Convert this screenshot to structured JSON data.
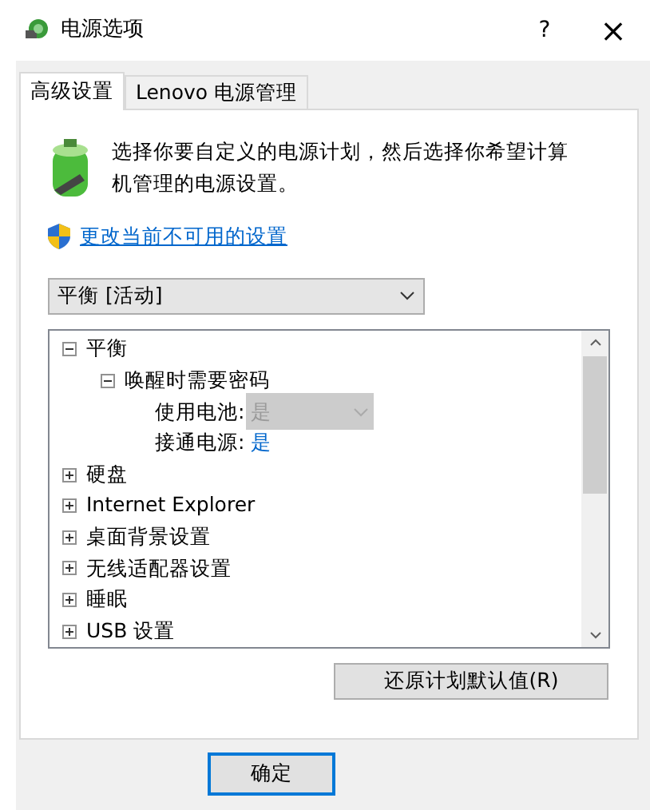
{
  "window": {
    "title": "电源选项",
    "help": "?",
    "close": "×"
  },
  "tabs": [
    {
      "label": "高级设置",
      "selected": true
    },
    {
      "label": "Lenovo 电源管理",
      "selected": false
    }
  ],
  "intro": "选择你要自定义的电源计划，然后选择你希望计算机管理的电源设置。",
  "link": "更改当前不可用的设置",
  "plan": {
    "value": "平衡 [活动]"
  },
  "tree": [
    {
      "kind": "group",
      "label": "平衡",
      "expanded": true,
      "children": [
        {
          "kind": "group",
          "label": "唤醒时需要密码",
          "expanded": true,
          "children": [
            {
              "kind": "dropdown",
              "label": "使用电池:",
              "value": "是",
              "disabled": true
            },
            {
              "kind": "link",
              "label": "接通电源:",
              "value": "是"
            }
          ]
        }
      ]
    },
    {
      "kind": "group",
      "label": "硬盘",
      "expanded": false
    },
    {
      "kind": "group",
      "label": "Internet Explorer",
      "expanded": false
    },
    {
      "kind": "group",
      "label": "桌面背景设置",
      "expanded": false
    },
    {
      "kind": "group",
      "label": "无线适配器设置",
      "expanded": false
    },
    {
      "kind": "group",
      "label": "睡眠",
      "expanded": false
    },
    {
      "kind": "group",
      "label": "USB 设置",
      "expanded": false
    }
  ],
  "restore_button": "还原计划默认值(R)",
  "buttons": [
    {
      "label": "确定",
      "default": true
    }
  ]
}
